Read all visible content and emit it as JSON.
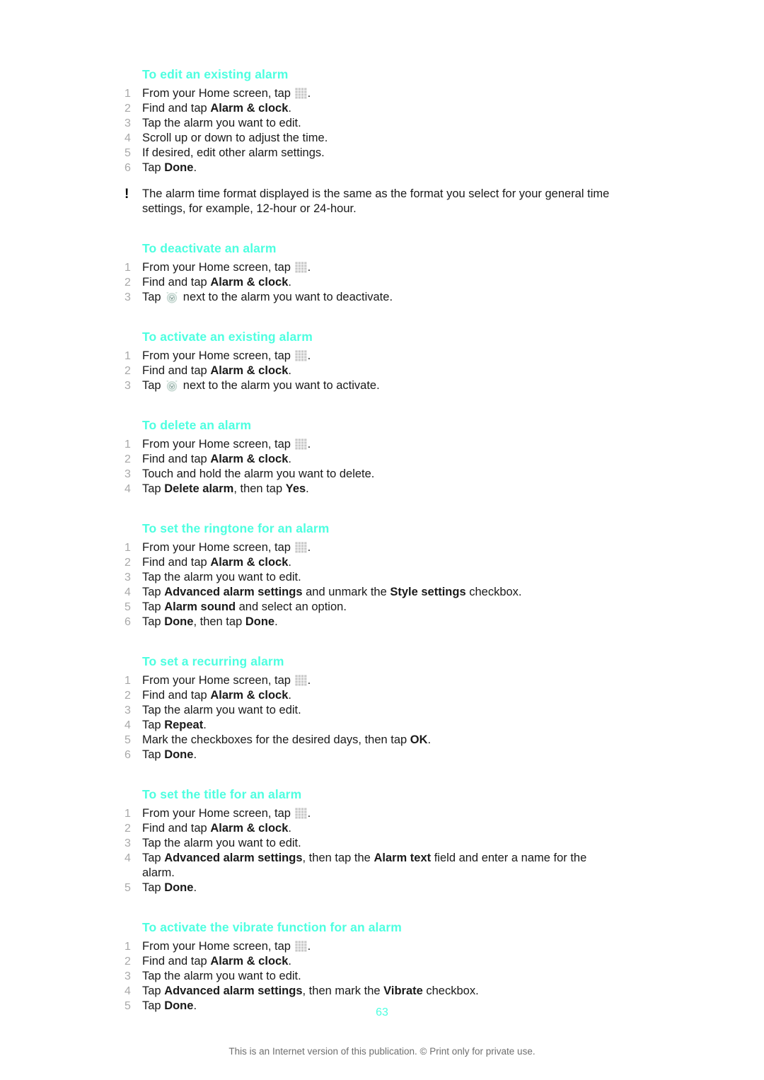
{
  "document": {
    "page_number": "63",
    "footer_note": "This is an Internet version of this publication. © Print only for private use.",
    "heading_color": "#4dffe0",
    "step_number_color": "#a8a8a8",
    "body_color": "#1a1a1a",
    "footer_color": "#6e6e6e"
  },
  "icons": {
    "app_grid": "app-grid-icon",
    "alarm_toggle": "alarm-clock-icon",
    "note": "exclamation-icon"
  },
  "sections": [
    {
      "heading": "To edit an existing alarm",
      "steps": [
        {
          "num": "1",
          "parts": [
            {
              "t": "From your Home screen, tap "
            },
            {
              "icon": "app-grid"
            },
            {
              "t": "."
            }
          ]
        },
        {
          "num": "2",
          "parts": [
            {
              "t": "Find and tap "
            },
            {
              "t": "Alarm & clock",
              "b": true
            },
            {
              "t": "."
            }
          ]
        },
        {
          "num": "3",
          "parts": [
            {
              "t": "Tap the alarm you want to edit."
            }
          ]
        },
        {
          "num": "4",
          "parts": [
            {
              "t": "Scroll up or down to adjust the time."
            }
          ]
        },
        {
          "num": "5",
          "parts": [
            {
              "t": "If desired, edit other alarm settings."
            }
          ]
        },
        {
          "num": "6",
          "parts": [
            {
              "t": "Tap "
            },
            {
              "t": "Done",
              "b": true
            },
            {
              "t": "."
            }
          ]
        }
      ],
      "note": "The alarm time format displayed is the same as the format you select for your general time settings, for example, 12-hour or 24-hour."
    },
    {
      "heading": "To deactivate an alarm",
      "steps": [
        {
          "num": "1",
          "parts": [
            {
              "t": "From your Home screen, tap "
            },
            {
              "icon": "app-grid"
            },
            {
              "t": "."
            }
          ]
        },
        {
          "num": "2",
          "parts": [
            {
              "t": "Find and tap "
            },
            {
              "t": "Alarm & clock",
              "b": true
            },
            {
              "t": "."
            }
          ]
        },
        {
          "num": "3",
          "parts": [
            {
              "t": "Tap "
            },
            {
              "icon": "alarm-toggle"
            },
            {
              "t": " next to the alarm you want to deactivate."
            }
          ]
        }
      ]
    },
    {
      "heading": "To activate an existing alarm",
      "steps": [
        {
          "num": "1",
          "parts": [
            {
              "t": "From your Home screen, tap "
            },
            {
              "icon": "app-grid"
            },
            {
              "t": "."
            }
          ]
        },
        {
          "num": "2",
          "parts": [
            {
              "t": "Find and tap "
            },
            {
              "t": "Alarm & clock",
              "b": true
            },
            {
              "t": "."
            }
          ]
        },
        {
          "num": "3",
          "parts": [
            {
              "t": "Tap "
            },
            {
              "icon": "alarm-toggle"
            },
            {
              "t": " next to the alarm you want to activate."
            }
          ]
        }
      ]
    },
    {
      "heading": "To delete an alarm",
      "steps": [
        {
          "num": "1",
          "parts": [
            {
              "t": "From your Home screen, tap "
            },
            {
              "icon": "app-grid"
            },
            {
              "t": "."
            }
          ]
        },
        {
          "num": "2",
          "parts": [
            {
              "t": "Find and tap "
            },
            {
              "t": "Alarm & clock",
              "b": true
            },
            {
              "t": "."
            }
          ]
        },
        {
          "num": "3",
          "parts": [
            {
              "t": "Touch and hold the alarm you want to delete."
            }
          ]
        },
        {
          "num": "4",
          "parts": [
            {
              "t": "Tap "
            },
            {
              "t": "Delete alarm",
              "b": true
            },
            {
              "t": ", then tap "
            },
            {
              "t": "Yes",
              "b": true
            },
            {
              "t": "."
            }
          ]
        }
      ]
    },
    {
      "heading": "To set the ringtone for an alarm",
      "steps": [
        {
          "num": "1",
          "parts": [
            {
              "t": "From your Home screen, tap "
            },
            {
              "icon": "app-grid"
            },
            {
              "t": "."
            }
          ]
        },
        {
          "num": "2",
          "parts": [
            {
              "t": "Find and tap "
            },
            {
              "t": "Alarm & clock",
              "b": true
            },
            {
              "t": "."
            }
          ]
        },
        {
          "num": "3",
          "parts": [
            {
              "t": "Tap the alarm you want to edit."
            }
          ]
        },
        {
          "num": "4",
          "parts": [
            {
              "t": "Tap "
            },
            {
              "t": "Advanced alarm settings",
              "b": true
            },
            {
              "t": " and unmark the "
            },
            {
              "t": "Style settings",
              "b": true
            },
            {
              "t": " checkbox."
            }
          ]
        },
        {
          "num": "5",
          "parts": [
            {
              "t": "Tap "
            },
            {
              "t": "Alarm sound",
              "b": true
            },
            {
              "t": " and select an option."
            }
          ]
        },
        {
          "num": "6",
          "parts": [
            {
              "t": "Tap "
            },
            {
              "t": "Done",
              "b": true
            },
            {
              "t": ", then tap "
            },
            {
              "t": "Done",
              "b": true
            },
            {
              "t": "."
            }
          ]
        }
      ]
    },
    {
      "heading": "To set a recurring alarm",
      "steps": [
        {
          "num": "1",
          "parts": [
            {
              "t": "From your Home screen, tap "
            },
            {
              "icon": "app-grid"
            },
            {
              "t": "."
            }
          ]
        },
        {
          "num": "2",
          "parts": [
            {
              "t": "Find and tap "
            },
            {
              "t": "Alarm & clock",
              "b": true
            },
            {
              "t": "."
            }
          ]
        },
        {
          "num": "3",
          "parts": [
            {
              "t": "Tap the alarm you want to edit."
            }
          ]
        },
        {
          "num": "4",
          "parts": [
            {
              "t": "Tap "
            },
            {
              "t": "Repeat",
              "b": true
            },
            {
              "t": "."
            }
          ]
        },
        {
          "num": "5",
          "parts": [
            {
              "t": "Mark the checkboxes for the desired days, then tap "
            },
            {
              "t": "OK",
              "b": true
            },
            {
              "t": "."
            }
          ]
        },
        {
          "num": "6",
          "parts": [
            {
              "t": "Tap "
            },
            {
              "t": "Done",
              "b": true
            },
            {
              "t": "."
            }
          ]
        }
      ]
    },
    {
      "heading": "To set the title for an alarm",
      "steps": [
        {
          "num": "1",
          "parts": [
            {
              "t": "From your Home screen, tap "
            },
            {
              "icon": "app-grid"
            },
            {
              "t": "."
            }
          ]
        },
        {
          "num": "2",
          "parts": [
            {
              "t": "Find and tap "
            },
            {
              "t": "Alarm & clock",
              "b": true
            },
            {
              "t": "."
            }
          ]
        },
        {
          "num": "3",
          "parts": [
            {
              "t": "Tap the alarm you want to edit."
            }
          ]
        },
        {
          "num": "4",
          "parts": [
            {
              "t": "Tap "
            },
            {
              "t": "Advanced alarm settings",
              "b": true
            },
            {
              "t": ", then tap the "
            },
            {
              "t": "Alarm text",
              "b": true
            },
            {
              "t": " field and enter a name for the alarm."
            }
          ]
        },
        {
          "num": "5",
          "parts": [
            {
              "t": "Tap "
            },
            {
              "t": "Done",
              "b": true
            },
            {
              "t": "."
            }
          ]
        }
      ]
    },
    {
      "heading": "To activate the vibrate function for an alarm",
      "steps": [
        {
          "num": "1",
          "parts": [
            {
              "t": "From your Home screen, tap "
            },
            {
              "icon": "app-grid"
            },
            {
              "t": "."
            }
          ]
        },
        {
          "num": "2",
          "parts": [
            {
              "t": "Find and tap "
            },
            {
              "t": "Alarm & clock",
              "b": true
            },
            {
              "t": "."
            }
          ]
        },
        {
          "num": "3",
          "parts": [
            {
              "t": "Tap the alarm you want to edit."
            }
          ]
        },
        {
          "num": "4",
          "parts": [
            {
              "t": "Tap "
            },
            {
              "t": "Advanced alarm settings",
              "b": true
            },
            {
              "t": ", then mark the "
            },
            {
              "t": "Vibrate",
              "b": true
            },
            {
              "t": " checkbox."
            }
          ]
        },
        {
          "num": "5",
          "parts": [
            {
              "t": "Tap "
            },
            {
              "t": "Done",
              "b": true
            },
            {
              "t": "."
            }
          ]
        }
      ]
    }
  ]
}
